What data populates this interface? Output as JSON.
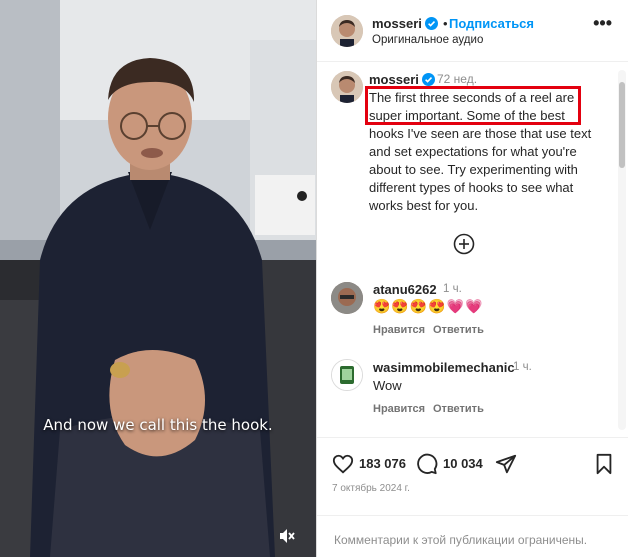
{
  "video": {
    "subtitle": "And now we call this the hook.",
    "mute_icon": "speaker-muted-icon"
  },
  "header": {
    "username": "mosseri",
    "separator": "•",
    "follow_label": "Подписаться",
    "audio_label": "Оригинальное аудио",
    "more_label": "•••"
  },
  "caption": {
    "username": "mosseri",
    "time": "72 нед.",
    "text": "The first three seconds of a reel are super important. Some of the best hooks I've seen are those that use text and set expectations for what you're about to see. Try experimenting with different types of hooks to see what works best for you."
  },
  "comments": [
    {
      "username": "atanu6262",
      "time": "1 ч.",
      "text": "😍😍😍😍💗💗",
      "like_label": "Нравится",
      "reply_label": "Ответить"
    },
    {
      "username": "wasimmobilemechanic",
      "time": "1 ч.",
      "text": "Wow",
      "like_label": "Нравится",
      "reply_label": "Ответить"
    }
  ],
  "actions": {
    "likes": "183 076",
    "comment_count": "10 034",
    "date": "7 октябрь 2024 г."
  },
  "footer": {
    "restricted_text": "Комментарии к этой публикации ограничены."
  },
  "colors": {
    "accent": "#0095f6",
    "highlight": "#e3000f",
    "verified": "#0095f6"
  }
}
